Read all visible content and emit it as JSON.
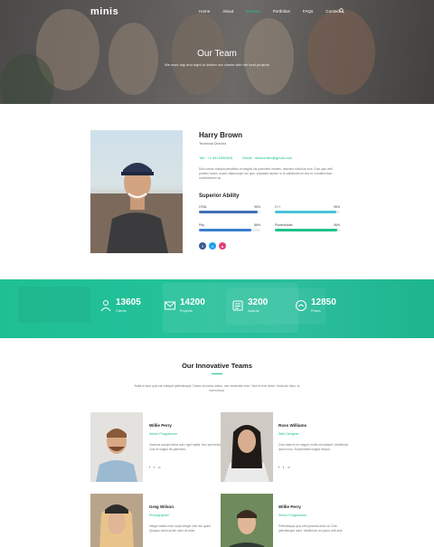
{
  "brand": {
    "logo": "minis",
    "accent": "#1ec28b"
  },
  "nav": {
    "items": [
      "Home",
      "About",
      "Service",
      "Portfolios",
      "FAQs",
      "Contact"
    ],
    "active": "Service"
  },
  "hero": {
    "title": "Our Team",
    "subtitle": "We work day and night to deliver our clients with the best projects"
  },
  "profile": {
    "name": "Harry Brown",
    "role": "Technical Director",
    "phone": "Tell : +1 8412590545",
    "email": "Email : dinnkonlev@gmail.com",
    "bio": "Duis varius volutpat penatibus et magnis dis parturient montes, nascetur ridiculus mus. Duis quis velit porttitor lorem, auctor ullamcorper dui quis. vulputate lacinia. In id sollicitudin mi sed et. condimentum condimentum ac.",
    "skills_title": "Superior Ability",
    "skills": [
      {
        "name": "HTML",
        "value": 95,
        "label": "95%",
        "color": "#3f6fb5"
      },
      {
        "name": "C++",
        "value": 95,
        "label": "95%",
        "color": "#4bc3d8"
      },
      {
        "name": "Php",
        "value": 86,
        "label": "86%",
        "color": "#3a7fd0"
      },
      {
        "name": "Powerbuilder",
        "value": 96,
        "label": "96%",
        "color": "#1ec28b"
      }
    ],
    "socials": [
      {
        "icon": "facebook-icon",
        "glyph": "f",
        "color": "#3b5998"
      },
      {
        "icon": "twitter-icon",
        "glyph": "t",
        "color": "#1da1f2"
      },
      {
        "icon": "instagram-icon",
        "glyph": "o",
        "color": "#e4407a"
      }
    ]
  },
  "stats": [
    {
      "icon": "client-icon",
      "number": "13605",
      "label": "Clients"
    },
    {
      "icon": "projects-icon",
      "number": "14200",
      "label": "Projects"
    },
    {
      "icon": "awards-icon",
      "number": "3200",
      "label": "Awards"
    },
    {
      "icon": "prizes-icon",
      "number": "12850",
      "label": "Prizes"
    }
  ],
  "teams": {
    "title": "Our Innovative Teams",
    "description": "Nulla et arcu quis est volutpat pellentesque. Donec at luctus metus, non venenatis enim. Sed et eros lorem. Nulla dui risus, ut lorem litora.",
    "members": [
      {
        "name": "Willie Perry",
        "role": "Senior Programmer",
        "bio": "Vivamus suscipit tellus nunc eget mattis. Nec sed lectus. Cras et magna dis parturient."
      },
      {
        "name": "Ross Williams",
        "role": "Web Designer",
        "bio": "Cras vitae ex eu magna, mollis sed aliquet. Vestibulum ipsum mus. Suspendisse magna tempor."
      },
      {
        "name": "Greg Wilson",
        "role": "Photographer",
        "bio": "Integer mattis enim turpis integer velit nec quam. Quisque lorem ipsum dolor sit amet."
      },
      {
        "name": "Willie Perry",
        "role": "Senior Programmer",
        "bio": "Pellentesque quis velit pharetra dolor sit. Duis pellentesque dolor. Vestibulum ac ipsum velit ante."
      }
    ]
  }
}
